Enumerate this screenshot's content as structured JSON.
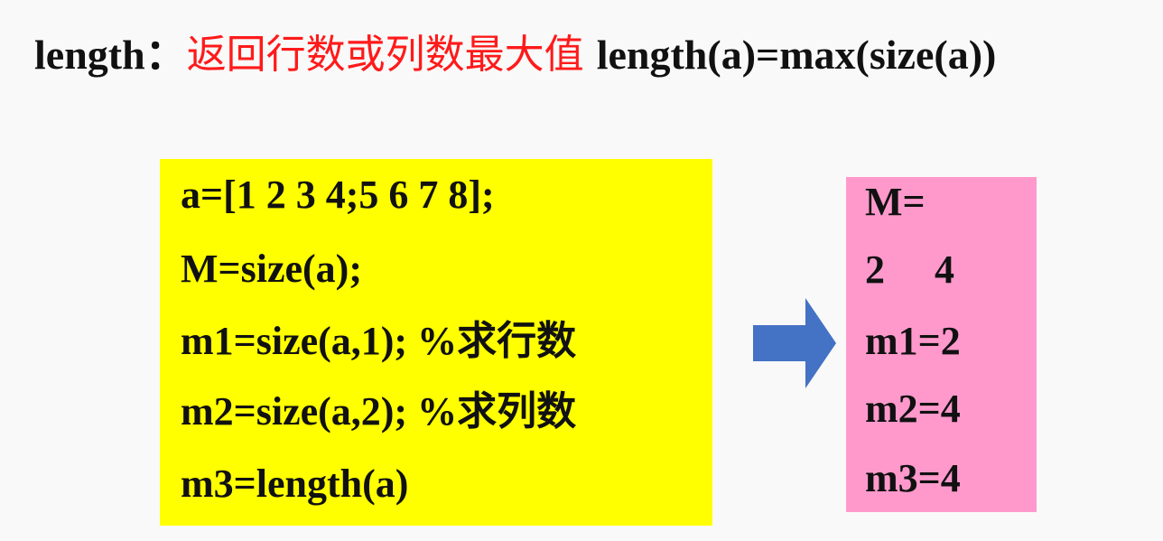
{
  "headline": {
    "term": "length：",
    "description": "返回行数或列数最大值",
    "formula": "length(a)=max(size(a))"
  },
  "code_box": {
    "lines": [
      {
        "code": "a=[1 2 3 4;5 6 7 8];",
        "comment": ""
      },
      {
        "code": "M=size(a);",
        "comment": ""
      },
      {
        "code": "m1=size(a,1); %",
        "comment": "求行数"
      },
      {
        "code": "m2=size(a,2); %",
        "comment": "求列数"
      },
      {
        "code": "m3=length(a)",
        "comment": ""
      }
    ],
    "background": "#ffff00"
  },
  "arrow": {
    "icon": "right-arrow-icon",
    "color": "#4472c4"
  },
  "result_box": {
    "lines": [
      "M=",
      "2     4",
      "m1=2",
      "m2=4",
      "m3=4"
    ],
    "background": "#ff99cc"
  },
  "colors": {
    "accent_red": "#ff1a1a",
    "text": "#111111",
    "page_background": "#f9f9f9"
  }
}
